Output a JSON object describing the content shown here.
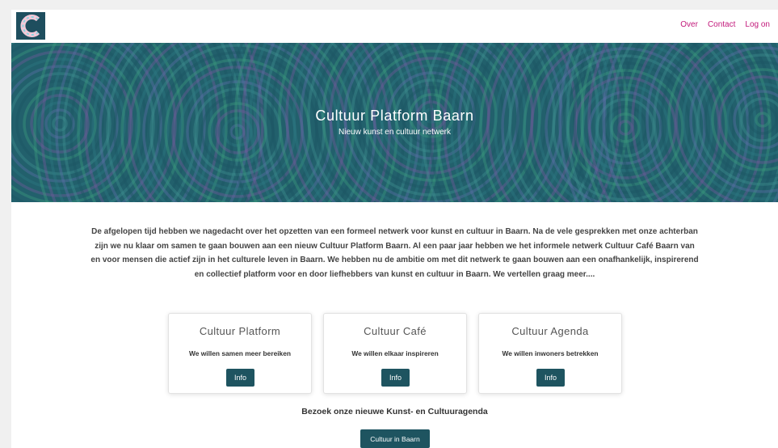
{
  "header": {
    "logo_letter": "C",
    "nav": [
      "Over",
      "Contact",
      "Log on"
    ]
  },
  "hero": {
    "title": "Cultuur Platform Baarn",
    "subtitle": "Nieuw kunst en cultuur netwerk"
  },
  "intro_text": "De afgelopen tijd hebben we nagedacht over het opzetten van een formeel netwerk voor kunst en cultuur in Baarn. Na de vele gesprekken met onze achterban zijn we nu klaar om samen te gaan bouwen aan een nieuw Cultuur Platform Baarn. Al een paar jaar hebben we het informele netwerk Cultuur Café Baarn van en voor mensen die actief zijn in het culturele leven in Baarn. We hebben nu de ambitie om met dit netwerk te gaan bouwen aan een onafhankelijk, inspirerend en collectief platform voor en door liefhebbers van kunst en cultuur in Baarn. We vertellen graag meer....",
  "cards": [
    {
      "title": "Cultuur Platform",
      "text": "We willen samen meer bereiken",
      "button": "Info"
    },
    {
      "title": "Cultuur Café",
      "text": "We willen elkaar inspireren",
      "button": "Info"
    },
    {
      "title": "Cultuur Agenda",
      "text": "We willen inwoners betrekken",
      "button": "Info"
    }
  ],
  "bottom": {
    "text": "Bezoek onze nieuwe Kunst- en Cultuuragenda",
    "button": "Cultuur in Baarn"
  },
  "colors": {
    "accent": "#c2187a",
    "button": "#1e5460",
    "hero_base": "#22606c"
  }
}
